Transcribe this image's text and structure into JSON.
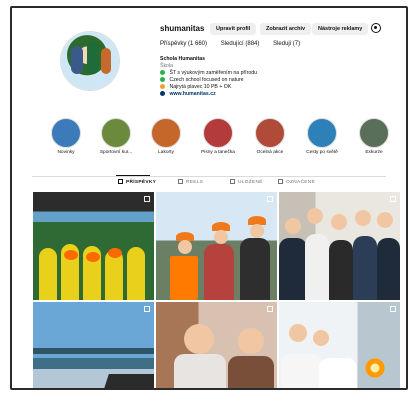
{
  "profile": {
    "username": "shumanitas",
    "buttons": {
      "edit": "Upravit profil",
      "archive": "Zobrazit archiv",
      "ads": "Nástroje reklamy"
    },
    "stats": {
      "posts": "Příspěvky (1 660)",
      "followers": "Sledující (884)",
      "following": "Sleduji (7)"
    },
    "bio": {
      "name": "Schola Humanitas",
      "category": "Škola",
      "lines": [
        "ŠT s výukovým zaměřením na přírodu",
        "Czech school focused on nature",
        "Najrytá plavec 10 PB + OK",
        "www.humanitas.cz"
      ]
    }
  },
  "highlights": [
    {
      "label": "Novinky",
      "color": "#3d7ab9"
    },
    {
      "label": "Sportovní kur...",
      "color": "#6c8a3b"
    },
    {
      "label": "Lakorty",
      "color": "#c5662a"
    },
    {
      "label": "Pisny a tanečka",
      "color": "#b43b3b"
    },
    {
      "label": "Ocelná akce",
      "color": "#b04b3a"
    },
    {
      "label": "Cesty po světě",
      "color": "#2e80b8"
    },
    {
      "label": "Exkurze",
      "color": "#5a6f5a"
    }
  ],
  "tabs": [
    "PŘÍSPĚVKY",
    "REELS",
    "ULOŽENÉ",
    "OZNAČENÉ"
  ],
  "colors": {
    "link": "#00376b",
    "muted": "#737373",
    "orange": "#ff7a00"
  }
}
